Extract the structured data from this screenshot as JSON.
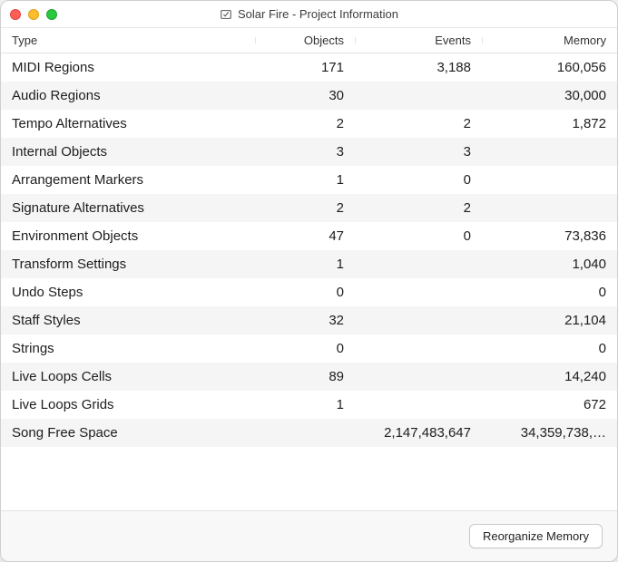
{
  "window": {
    "title": "Solar Fire - Project Information"
  },
  "columns": {
    "type": "Type",
    "objects": "Objects",
    "events": "Events",
    "memory": "Memory"
  },
  "rows": [
    {
      "type": "MIDI Regions",
      "objects": "171",
      "events": "3,188",
      "memory": "160,056"
    },
    {
      "type": "Audio Regions",
      "objects": "30",
      "events": "",
      "memory": "30,000"
    },
    {
      "type": "Tempo Alternatives",
      "objects": "2",
      "events": "2",
      "memory": "1,872"
    },
    {
      "type": "Internal Objects",
      "objects": "3",
      "events": "3",
      "memory": ""
    },
    {
      "type": "Arrangement Markers",
      "objects": "1",
      "events": "0",
      "memory": ""
    },
    {
      "type": "Signature Alternatives",
      "objects": "2",
      "events": "2",
      "memory": ""
    },
    {
      "type": "Environment Objects",
      "objects": "47",
      "events": "0",
      "memory": "73,836"
    },
    {
      "type": "Transform Settings",
      "objects": "1",
      "events": "",
      "memory": "1,040"
    },
    {
      "type": "Undo Steps",
      "objects": "0",
      "events": "",
      "memory": "0"
    },
    {
      "type": "Staff Styles",
      "objects": "32",
      "events": "",
      "memory": "21,104"
    },
    {
      "type": "Strings",
      "objects": "0",
      "events": "",
      "memory": "0"
    },
    {
      "type": "Live Loops Cells",
      "objects": "89",
      "events": "",
      "memory": "14,240"
    },
    {
      "type": "Live Loops Grids",
      "objects": "1",
      "events": "",
      "memory": "672"
    },
    {
      "type": "Song Free Space",
      "objects": "",
      "events": "2,147,483,647",
      "memory": "34,359,738,…"
    }
  ],
  "footer": {
    "reorganize_label": "Reorganize Memory"
  }
}
